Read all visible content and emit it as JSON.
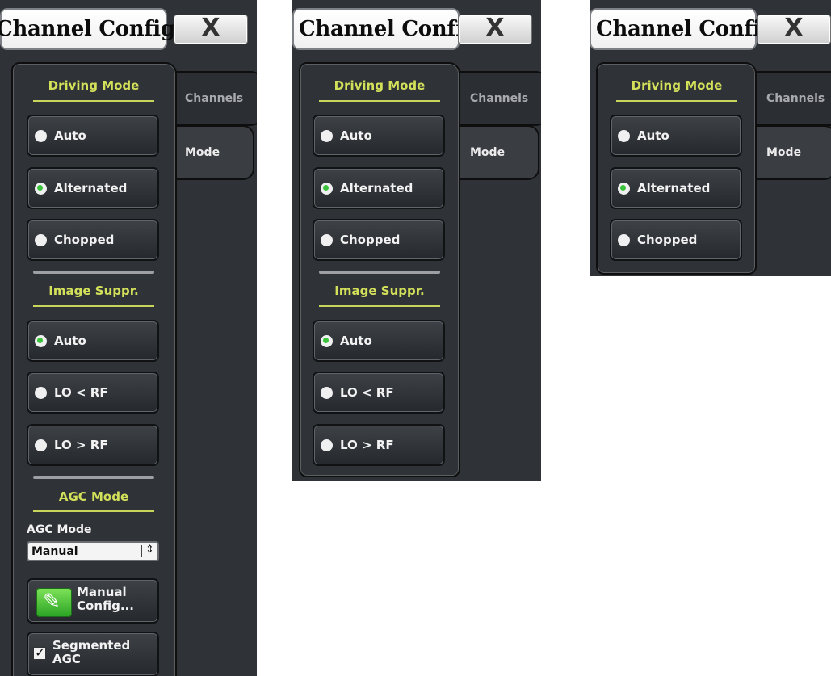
{
  "panels": [
    {
      "title": "Channel Config",
      "close_label": "X",
      "tabs": {
        "channels": "Channels",
        "mode": "Mode"
      },
      "driving_mode": {
        "title": "Driving Mode",
        "options": [
          {
            "label": "Auto",
            "selected": false
          },
          {
            "label": "Alternated",
            "selected": true
          },
          {
            "label": "Chopped",
            "selected": false
          }
        ]
      },
      "image_suppr": {
        "title": "Image Suppr.",
        "options": [
          {
            "label": "Auto",
            "selected": true
          },
          {
            "label": "LO < RF",
            "selected": false
          },
          {
            "label": "LO > RF",
            "selected": false
          }
        ]
      },
      "agc": {
        "title": "AGC Mode",
        "field_label": "AGC Mode",
        "select_value": "Manual",
        "manual_config_label": "Manual Config...",
        "segmented_label": "Segmented AGC",
        "segmented_checked": true
      }
    },
    {
      "title": "Channel Config",
      "close_label": "X",
      "tabs": {
        "channels": "Channels",
        "mode": "Mode"
      },
      "driving_mode": {
        "title": "Driving Mode",
        "options": [
          {
            "label": "Auto",
            "selected": false
          },
          {
            "label": "Alternated",
            "selected": true
          },
          {
            "label": "Chopped",
            "selected": false
          }
        ]
      },
      "image_suppr": {
        "title": "Image Suppr.",
        "options": [
          {
            "label": "Auto",
            "selected": true
          },
          {
            "label": "LO < RF",
            "selected": false
          },
          {
            "label": "LO > RF",
            "selected": false
          }
        ]
      }
    },
    {
      "title": "Channel Config",
      "close_label": "X",
      "tabs": {
        "channels": "Channels",
        "mode": "Mode"
      },
      "driving_mode": {
        "title": "Driving Mode",
        "options": [
          {
            "label": "Auto",
            "selected": false
          },
          {
            "label": "Alternated",
            "selected": true
          },
          {
            "label": "Chopped",
            "selected": false
          }
        ]
      }
    }
  ],
  "colors": {
    "panel_bg": "#2f3236",
    "section_title": "#d3e05a",
    "selected_dot": "#3ac23a"
  }
}
